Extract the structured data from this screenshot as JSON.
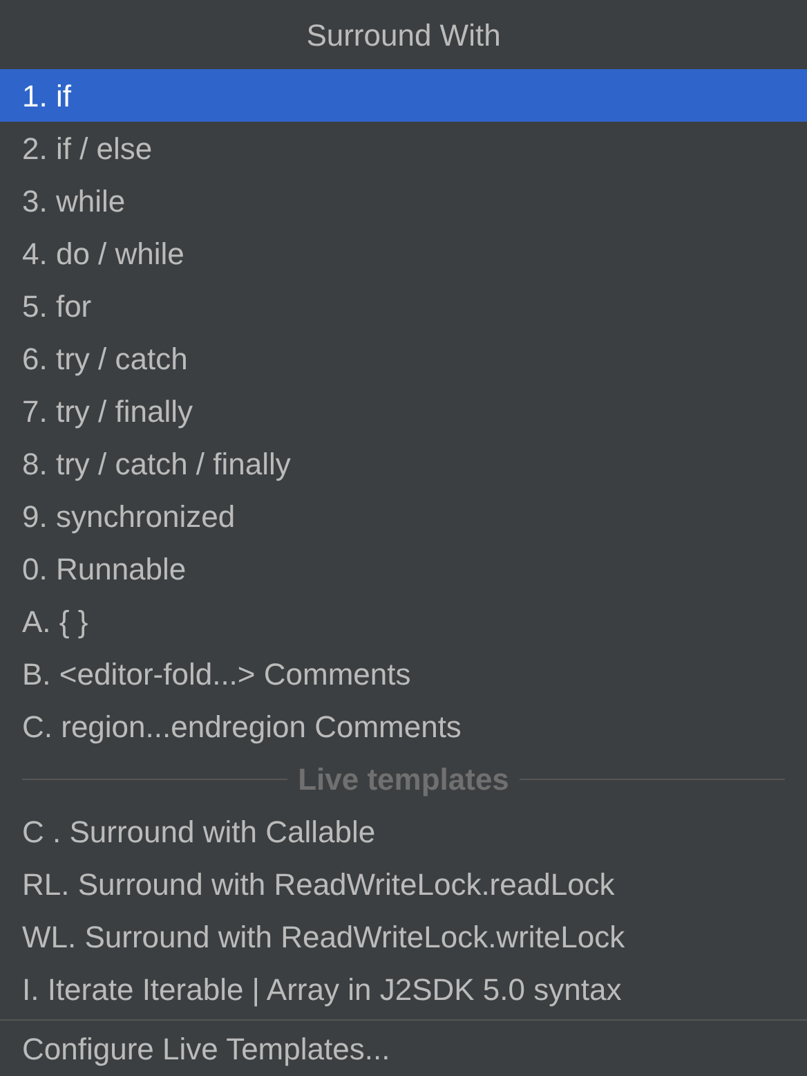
{
  "title": "Surround With",
  "items": [
    {
      "label": "1. if",
      "selected": true
    },
    {
      "label": "2. if / else",
      "selected": false
    },
    {
      "label": "3. while",
      "selected": false
    },
    {
      "label": "4. do / while",
      "selected": false
    },
    {
      "label": "5. for",
      "selected": false
    },
    {
      "label": "6. try / catch",
      "selected": false
    },
    {
      "label": "7. try / finally",
      "selected": false
    },
    {
      "label": "8. try / catch / finally",
      "selected": false
    },
    {
      "label": "9. synchronized",
      "selected": false
    },
    {
      "label": "0. Runnable",
      "selected": false
    },
    {
      "label": "A. { }",
      "selected": false
    },
    {
      "label": "B. <editor-fold...> Comments",
      "selected": false
    },
    {
      "label": "C. region...endregion Comments",
      "selected": false
    }
  ],
  "live_templates": {
    "heading": "Live templates",
    "items": [
      {
        "label": "C . Surround with Callable",
        "selected": false
      },
      {
        "label": "RL. Surround with ReadWriteLock.readLock",
        "selected": false
      },
      {
        "label": "WL. Surround with ReadWriteLock.writeLock",
        "selected": false
      },
      {
        "label": "I. Iterate Iterable | Array in J2SDK 5.0 syntax",
        "selected": false
      }
    ]
  },
  "footer_action": "Configure Live Templates..."
}
